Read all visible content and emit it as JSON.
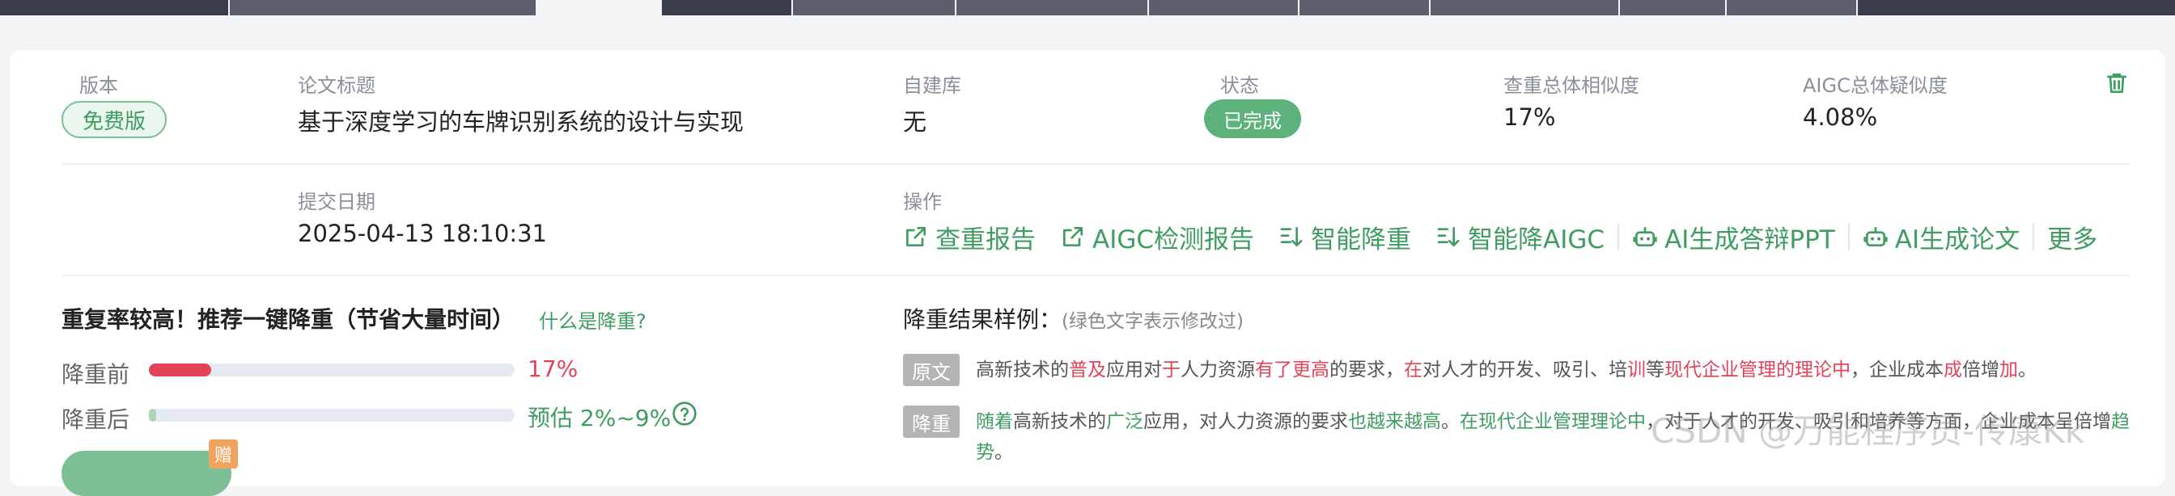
{
  "record": {
    "version_label": "版本",
    "version_value": "免费版",
    "title_label": "论文标题",
    "title_value": "基于深度学习的车牌识别系统的设计与实现",
    "library_label": "自建库",
    "library_value": "无",
    "status_label": "状态",
    "status_value": "已完成",
    "similarity_label": "查重总体相似度",
    "similarity_value": "17%",
    "aigc_label": "AIGC总体疑似度",
    "aigc_value": "4.08%",
    "date_label": "提交日期",
    "date_value": "2025-04-13 18:10:31",
    "ops_label": "操作"
  },
  "operations": [
    {
      "label": "查重报告",
      "icon": "external-link-icon"
    },
    {
      "label": "AIGC检测报告",
      "icon": "external-link-icon"
    },
    {
      "label": "智能降重",
      "icon": "sort-down-icon"
    },
    {
      "label": "智能降AIGC",
      "icon": "sort-down-icon"
    },
    {
      "label": "AI生成答辩PPT",
      "icon": "robot-icon"
    },
    {
      "label": "AI生成论文",
      "icon": "robot-icon"
    },
    {
      "label": "更多",
      "icon": ""
    }
  ],
  "reduce": {
    "title": "重复率较高！推荐一键降重（节省大量时间）",
    "help_link": "什么是降重?",
    "before_label": "降重前",
    "before_value": "17%",
    "before_fraction": 0.17,
    "after_label": "降重后",
    "after_value": "预估 2%~9%",
    "after_fraction": 0.02,
    "gift_label": "赠"
  },
  "example": {
    "title": "降重结果样例：",
    "hint": "(绿色文字表示修改过)",
    "original_tag": "原文",
    "reduced_tag": "降重"
  },
  "watermark": "CSDN @万能程序员-传康Kk",
  "colors": {
    "accent_green": "#3f9d62",
    "accent_red": "#e24357"
  }
}
